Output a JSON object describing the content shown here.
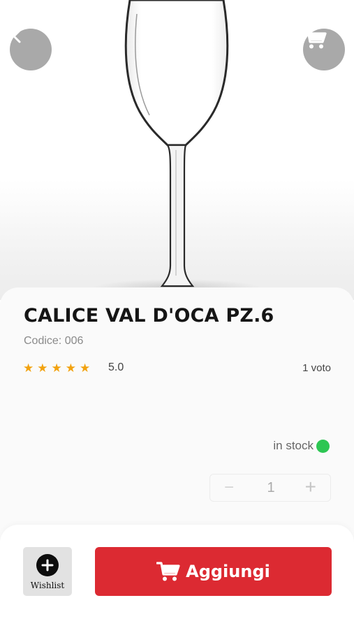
{
  "product": {
    "name": "CALICE VAL D'OCA PZ.6",
    "code": "Codice: 006",
    "rating_value": "5.0",
    "rating_stars": 5,
    "votes": "1 voto",
    "stock_label": "in stock",
    "stock_color": "#2dc653",
    "quantity": "1"
  },
  "header": {
    "back_icon": "chevron-left-icon",
    "cart_icon": "cart-icon"
  },
  "actions": {
    "wishlist_label": "Wishlist",
    "add_label": "Aggiungi",
    "add_color": "#dc2a32"
  },
  "quantity_stepper": {
    "minus": "−",
    "plus": "+"
  },
  "stars": [
    "★",
    "★",
    "★",
    "★",
    "★"
  ]
}
